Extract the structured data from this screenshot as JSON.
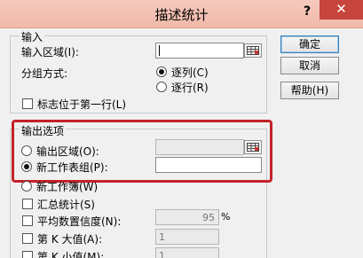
{
  "window": {
    "title": "描述统计",
    "help_glyph": "?",
    "close_glyph": "✕"
  },
  "input_section": {
    "heading": "输入",
    "input_range_label": "输入区域(I):",
    "input_range_value": "",
    "group_by_label": "分组方式:",
    "group_by_options": [
      {
        "label": "逐列(C)",
        "selected": true
      },
      {
        "label": "逐行(R)",
        "selected": false
      }
    ],
    "labels_first_row_label": "标志位于第一行(L)",
    "labels_first_row_checked": false
  },
  "buttons": {
    "ok": "确定",
    "cancel": "取消",
    "help": "帮助(H)"
  },
  "output_section": {
    "heading": "输出选项",
    "output_range_label": "输出区域(O):",
    "output_range_value": "",
    "new_worksheet_label": "新工作表组(P):",
    "new_worksheet_value": "",
    "new_workbook_label": "新工作簿(W)",
    "output_choice": "new_worksheet"
  },
  "summary_statistics_label": "汇总统计(S)",
  "confidence_label": "平均数置信度(N):",
  "confidence_value": "95",
  "confidence_unit": "%",
  "kth_largest_label": "第 K 大值(A):",
  "kth_largest_value": "1",
  "kth_smallest_label": "第 K 小值(M):",
  "kth_smallest_value": "1",
  "icons": {
    "ref_button": "range-select-icon"
  },
  "colors": {
    "highlight": "#c4222a",
    "close": "#c7453c",
    "titlebar": "#f3c2b4"
  }
}
